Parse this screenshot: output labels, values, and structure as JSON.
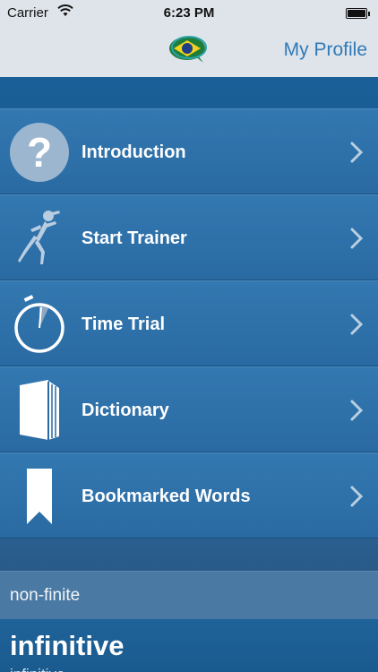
{
  "status_bar": {
    "carrier": "Carrier",
    "time": "6:23 PM",
    "wifi_icon": "wifi-icon",
    "battery_icon": "battery-icon"
  },
  "nav": {
    "logo_icon": "app-logo-icon",
    "profile_label": "My Profile"
  },
  "menu": {
    "items": [
      {
        "label": "Introduction",
        "icon": "question-icon"
      },
      {
        "label": "Start Trainer",
        "icon": "runner-icon"
      },
      {
        "label": "Time Trial",
        "icon": "stopwatch-icon"
      },
      {
        "label": "Dictionary",
        "icon": "book-icon"
      },
      {
        "label": "Bookmarked Words",
        "icon": "bookmark-icon"
      }
    ]
  },
  "word_panel": {
    "category": "non-finite",
    "word": "infinitive",
    "subtitle": "infinitive"
  },
  "colors": {
    "accent": "#2f7ab8",
    "menu_bg": "#2f73ab",
    "background": "#1b5a8c"
  }
}
